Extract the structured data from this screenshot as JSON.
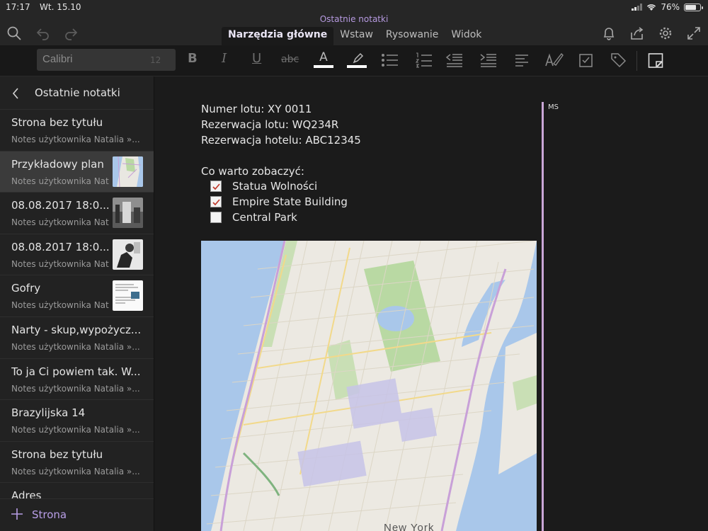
{
  "status": {
    "time": "17:17",
    "date": "Wt. 15.10",
    "battery": "76%",
    "battery_level": 0.76
  },
  "app": {
    "doc_title": "Ostatnie notatki",
    "tabs": [
      {
        "label": "Narzędzia główne",
        "active": true
      },
      {
        "label": "Wstaw",
        "active": false
      },
      {
        "label": "Rysowanie",
        "active": false
      },
      {
        "label": "Widok",
        "active": false
      }
    ],
    "left_icons": [
      "search-icon",
      "undo-icon",
      "redo-icon"
    ],
    "right_icons": [
      "bell-icon",
      "share-icon",
      "gear-icon",
      "expand-icon"
    ]
  },
  "toolbar": {
    "font": "Calibri",
    "size": "12",
    "bold": "B",
    "italic": "I",
    "underline": "U",
    "strike": "abc",
    "font_color_glyph": "A",
    "tools": [
      "bold-icon",
      "italic-icon",
      "underline-icon",
      "strikethrough-icon",
      "font-color-icon",
      "highlighter-icon",
      "bullet-list-icon",
      "numbered-list-icon",
      "outdent-icon",
      "indent-icon",
      "align-icon",
      "format-painter-icon",
      "todo-checkbox-icon",
      "tag-icon",
      "sticky-note-icon"
    ],
    "accent": "#b89ee6"
  },
  "sidebar": {
    "title": "Ostatnie notatki",
    "items": [
      {
        "title": "Strona bez tytułu",
        "sub": "Notes użytkownika Natalia »..."
      },
      {
        "title": "Przykładowy plan",
        "sub": "Notes użytkownika Natalia »...",
        "selected": true
      },
      {
        "title": "08.08.2017 18:0...",
        "sub": "Notes użytkownika Natalia »..."
      },
      {
        "title": "08.08.2017 18:0...",
        "sub": "Notes użytkownika Natalia »..."
      },
      {
        "title": "Gofry",
        "sub": "Notes użytkownika Natalia »..."
      },
      {
        "title": "Narty - skup,wypożycz...",
        "sub": "Notes użytkownika Natalia »..."
      },
      {
        "title": "To ja Ci powiem tak. W...",
        "sub": "Notes użytkownika Natalia »..."
      },
      {
        "title": "Brazylijska 14",
        "sub": "Notes użytkownika Natalia »..."
      },
      {
        "title": "Strona bez tytułu",
        "sub": "Notes użytkownika Natalia »..."
      },
      {
        "title": "Adres",
        "sub": ""
      }
    ],
    "add_page": "Strona"
  },
  "note": {
    "lines": [
      "Numer lotu: XY 0011",
      "Rezerwacja lotu: WQ234R",
      "Rezerwacja hotelu: ABC12345"
    ],
    "heading": "Co warto zobaczyć:",
    "todos": [
      {
        "label": "Statua Wolności",
        "checked": true
      },
      {
        "label": "Empire State Building",
        "checked": true
      },
      {
        "label": "Central Park",
        "checked": false
      }
    ],
    "author_tag": "MS",
    "map_label": "New York"
  }
}
